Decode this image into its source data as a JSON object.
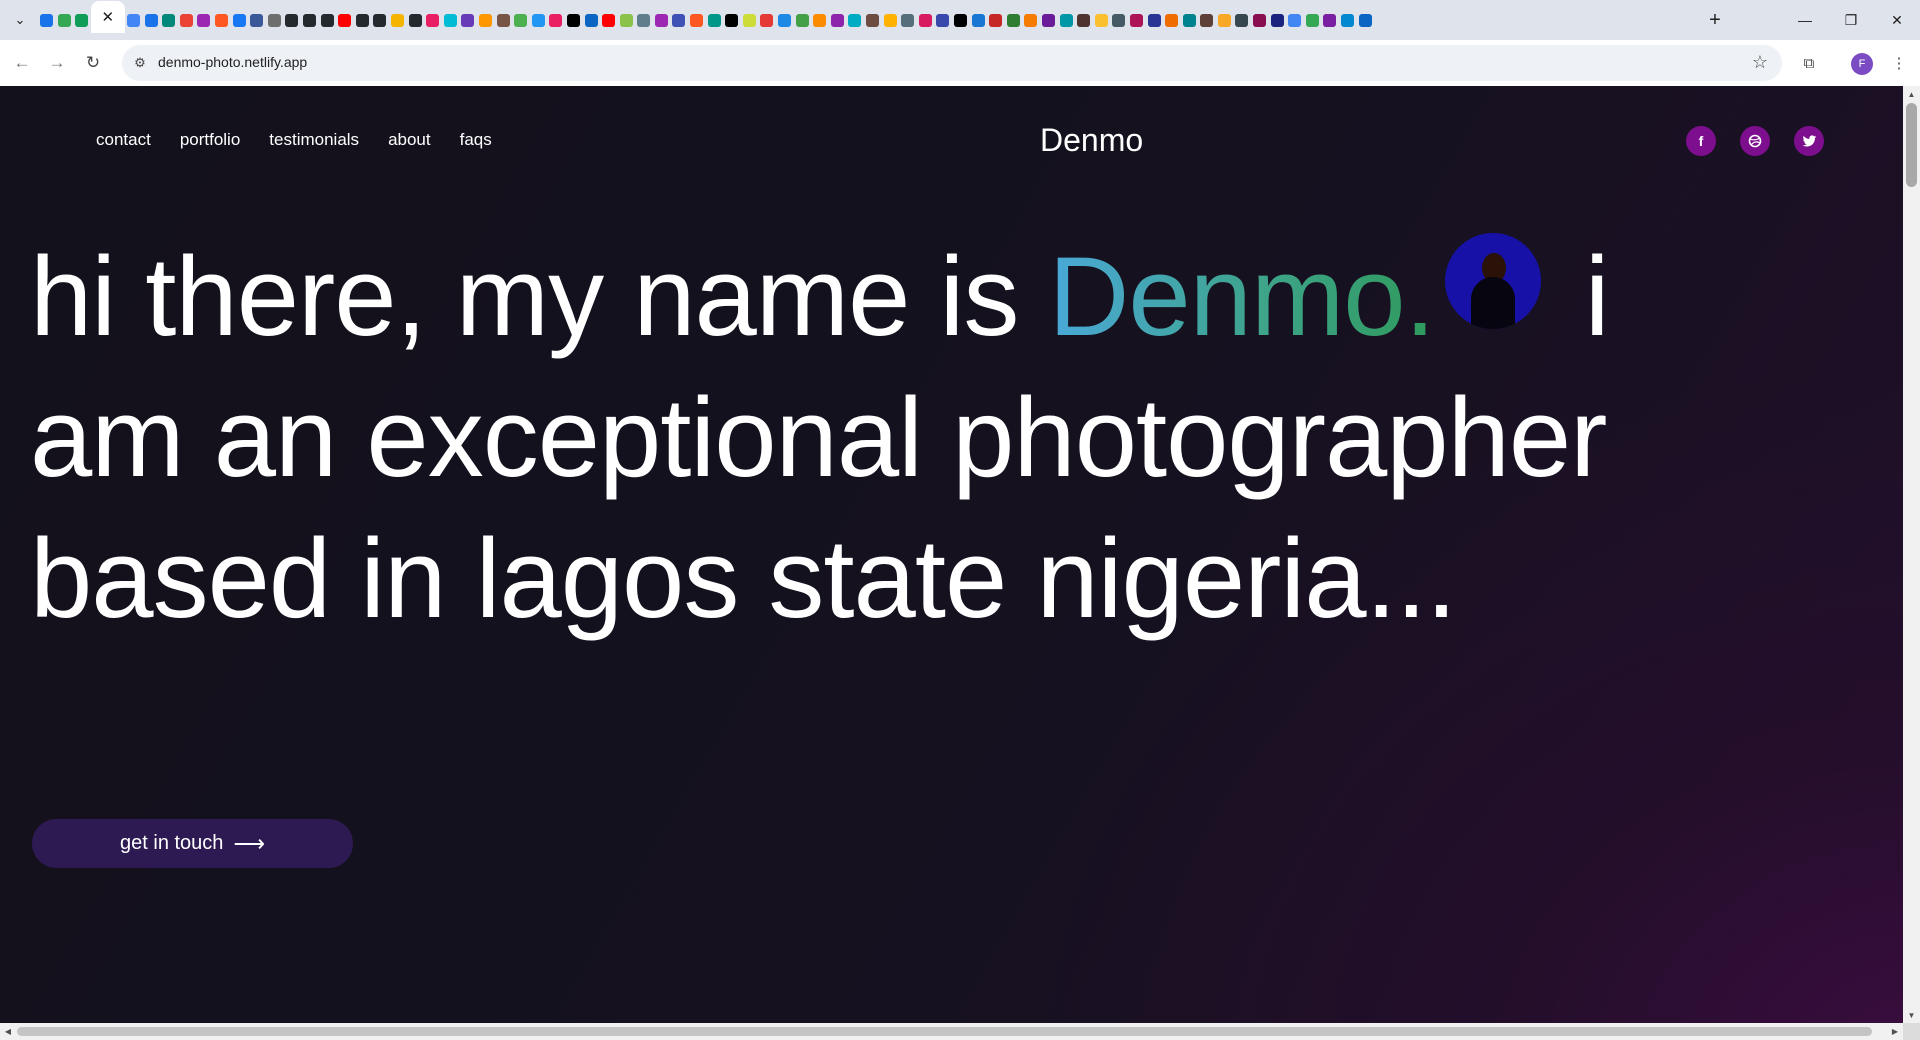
{
  "browser": {
    "active_tab_close": "✕",
    "new_tab": "+",
    "window_controls": {
      "minimize": "—",
      "restore": "❐",
      "close": "✕"
    },
    "url": "denmo-photo.netlify.app",
    "profile_initial": "F",
    "favicon_colors": [
      "#1a73e8",
      "#34a853",
      "#0f9d58",
      "#4285f4",
      "#1a73e8",
      "#00897b",
      "#ea4335",
      "#9c27b0",
      "#ff5722",
      "#1877f2",
      "#3b5998",
      "#6e6e6e",
      "#24292e",
      "#24292e",
      "#24292e",
      "#ff0000",
      "#24292e",
      "#24292e",
      "#f4b400",
      "#24292e",
      "#e91e63",
      "#00bcd4",
      "#673ab7",
      "#ff9800",
      "#795548",
      "#4caf50",
      "#2196f3",
      "#e91e63",
      "#000000",
      "#0a66c2",
      "#ff0000",
      "#8bc34a",
      "#607d8b",
      "#9c27b0",
      "#3f51b5",
      "#ff5722",
      "#009688",
      "#000000",
      "#cddc39",
      "#e53935",
      "#1e88e5",
      "#43a047",
      "#fb8c00",
      "#8e24aa",
      "#00acc1",
      "#6d4c41",
      "#ffb300",
      "#546e7a",
      "#d81b60",
      "#3949ab",
      "#000000",
      "#1976d2",
      "#c62828",
      "#2e7d32",
      "#f57c00",
      "#6a1b9a",
      "#0097a7",
      "#4e342e",
      "#fbc02d",
      "#455a64",
      "#ad1457",
      "#283593",
      "#ef6c00",
      "#00838f",
      "#5d4037",
      "#f9a825",
      "#37474f",
      "#880e4f",
      "#1a237e",
      "#4285f4",
      "#34a853",
      "#7b1fa2",
      "#0288d1",
      "#0a66c2"
    ]
  },
  "site": {
    "nav": [
      "contact",
      "portfolio",
      "testimonials",
      "about",
      "faqs"
    ],
    "brand": "Denmo",
    "social_icons": [
      "facebook-icon",
      "dribbble-icon",
      "twitter-icon"
    ],
    "hero": {
      "before": "hi there, my name is ",
      "name": "Denmo.",
      "after": " i am an exceptional photographer based in lagos state nigeria..."
    },
    "cta_label": "get in touch",
    "cta_arrow": "⟶"
  },
  "colors": {
    "background": "#13111c",
    "accent_purple": "#7d0f8f",
    "button_bg": "#2e1a52",
    "name_gradient_start": "#4aa8d8",
    "name_gradient_end": "#2f9a5c",
    "avatar_bg": "#1711a8"
  }
}
